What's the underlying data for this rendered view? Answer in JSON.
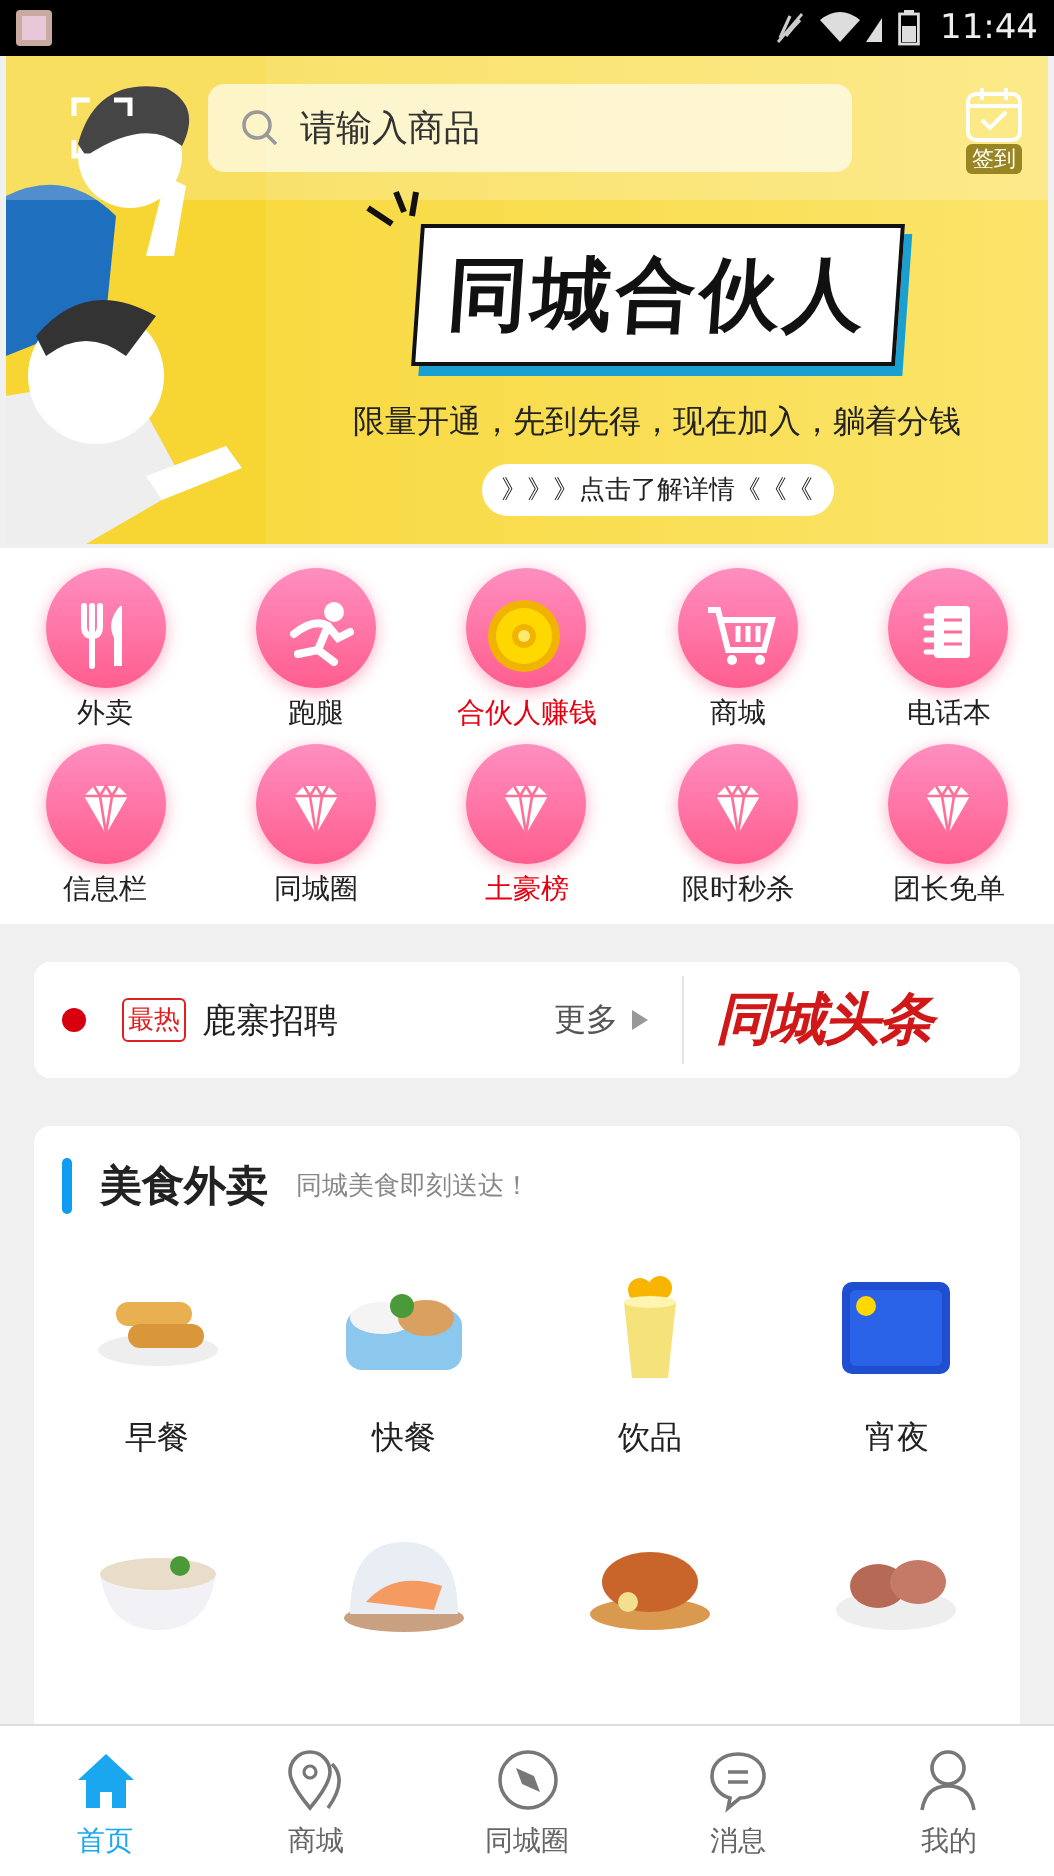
{
  "status_bar": {
    "time": "11:44"
  },
  "header": {
    "search": {
      "placeholder": "请输入商品"
    },
    "checkin": {
      "label": "签到"
    }
  },
  "banner": {
    "title": "同城合伙人",
    "subtitle": "限量开通，先到先得，现在加入，躺着分钱",
    "cta": "》》》点击了解详情《《《"
  },
  "menu": [
    {
      "label": "外卖",
      "kind": "cutlery",
      "highlight": false
    },
    {
      "label": "跑腿",
      "kind": "runner",
      "highlight": false
    },
    {
      "label": "合伙人赚钱",
      "kind": "coin",
      "highlight": true
    },
    {
      "label": "商城",
      "kind": "cart",
      "highlight": false
    },
    {
      "label": "电话本",
      "kind": "notebook",
      "highlight": false
    },
    {
      "label": "信息栏",
      "kind": "diamond",
      "highlight": false
    },
    {
      "label": "同城圈",
      "kind": "diamond",
      "highlight": false
    },
    {
      "label": "土豪榜",
      "kind": "diamond",
      "highlight": true
    },
    {
      "label": "限时秒杀",
      "kind": "diamond",
      "highlight": false
    },
    {
      "label": "团长免单",
      "kind": "diamond",
      "highlight": false
    }
  ],
  "news": {
    "tag": "最热",
    "headline": "鹿寨招聘",
    "more": "更多",
    "logo": "同城头条"
  },
  "food_section": {
    "title": "美食外卖",
    "subtitle": "同城美食即刻送达！",
    "items": [
      {
        "label": "早餐",
        "kind": "picture"
      },
      {
        "label": "快餐",
        "kind": "picture"
      },
      {
        "label": "饮品",
        "kind": "picture"
      },
      {
        "label": "宵夜",
        "kind": "picture"
      },
      {
        "kind": "picture"
      },
      {
        "kind": "picture"
      },
      {
        "kind": "picture"
      },
      {
        "kind": "picture"
      }
    ]
  },
  "tab_bar": [
    {
      "label": "首页",
      "kind": "home",
      "selected": true
    },
    {
      "label": "商城",
      "kind": "pin",
      "selected": false
    },
    {
      "label": "同城圈",
      "kind": "compass",
      "selected": false
    },
    {
      "label": "消息",
      "kind": "chat",
      "selected": false
    },
    {
      "label": "我的",
      "kind": "person",
      "selected": false
    }
  ]
}
